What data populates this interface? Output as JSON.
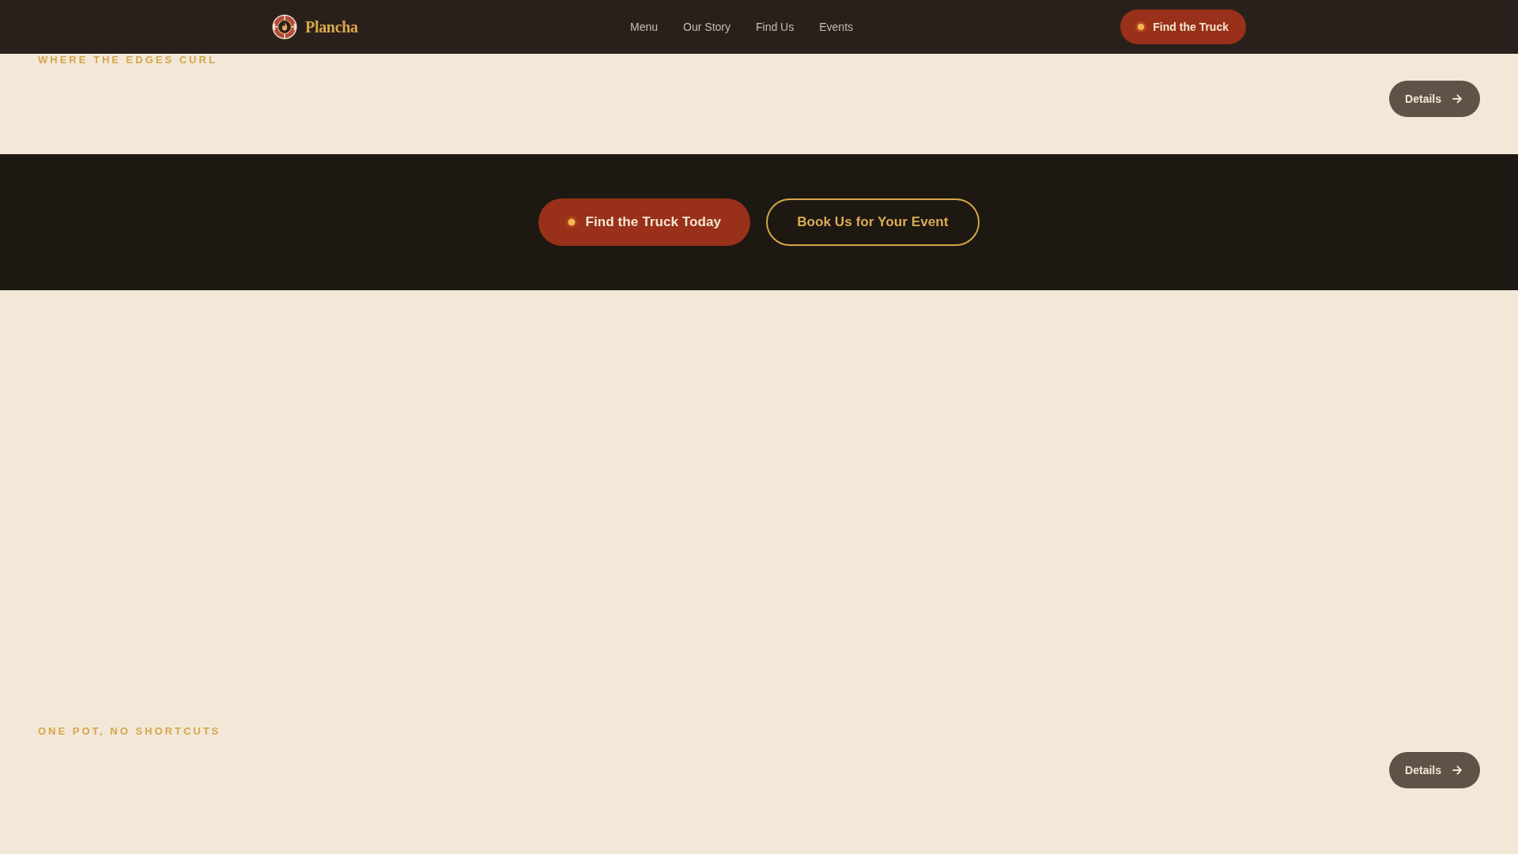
{
  "header": {
    "brand": "Plancha",
    "nav": [
      {
        "label": "Menu"
      },
      {
        "label": "Our Story"
      },
      {
        "label": "Find Us"
      },
      {
        "label": "Events"
      }
    ],
    "cta": {
      "label": "Find the Truck",
      "kind": "primary"
    }
  },
  "sections": [
    {
      "kind": "feature",
      "eyebrow": "WHERE THE EDGES CURL",
      "action": "Details"
    },
    {
      "kind": "cta",
      "buttons": [
        {
          "label": "Find the Truck Today",
          "kind": "primary"
        },
        {
          "label": "Book Us for Your Event",
          "kind": "outline"
        }
      ]
    },
    {
      "kind": "feature",
      "eyebrow": "ONE POT, NO SHORTCUTS",
      "action": "Details"
    }
  ]
}
